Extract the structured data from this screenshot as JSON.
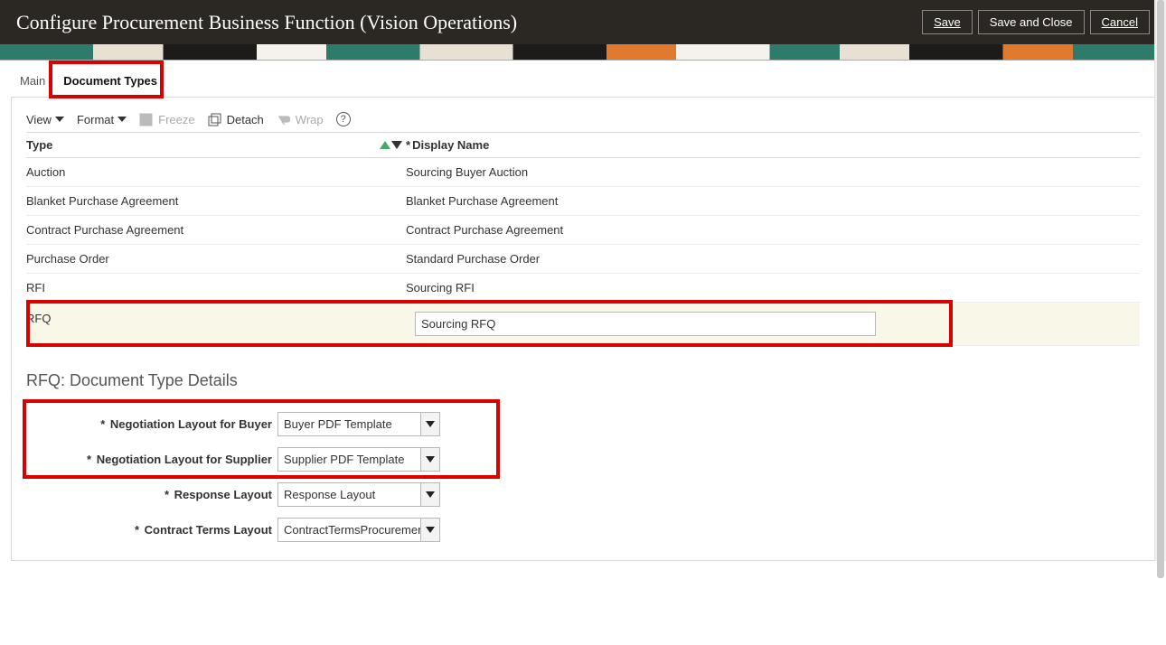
{
  "header": {
    "title": "Configure Procurement Business Function (Vision Operations)",
    "save": "Save",
    "saveClose": "Save and Close",
    "cancel": "Cancel"
  },
  "tabs": {
    "main": "Main",
    "documentTypes": "Document Types"
  },
  "toolbar": {
    "view": "View",
    "format": "Format",
    "freeze": "Freeze",
    "detach": "Detach",
    "wrap": "Wrap"
  },
  "grid": {
    "header": {
      "type": "Type",
      "displayName": "Display Name"
    },
    "rows": [
      {
        "type": "Auction",
        "name": "Sourcing Buyer Auction"
      },
      {
        "type": "Blanket Purchase Agreement",
        "name": "Blanket Purchase Agreement"
      },
      {
        "type": "Contract Purchase Agreement",
        "name": "Contract Purchase Agreement"
      },
      {
        "type": "Purchase Order",
        "name": "Standard Purchase Order"
      },
      {
        "type": "RFI",
        "name": "Sourcing RFI"
      }
    ],
    "selected": {
      "type": "RFQ",
      "name": "Sourcing RFQ"
    }
  },
  "details": {
    "heading": "RFQ: Document Type Details",
    "fields": {
      "buyerLayoutLabel": "Negotiation Layout for Buyer",
      "buyerLayoutValue": "Buyer PDF Template",
      "supplierLayoutLabel": "Negotiation Layout for Supplier",
      "supplierLayoutValue": "Supplier PDF Template",
      "responseLayoutLabel": "Response Layout",
      "responseLayoutValue": "Response Layout",
      "contractTermsLabel": "Contract Terms Layout",
      "contractTermsValue": "ContractTermsProcurement"
    }
  }
}
